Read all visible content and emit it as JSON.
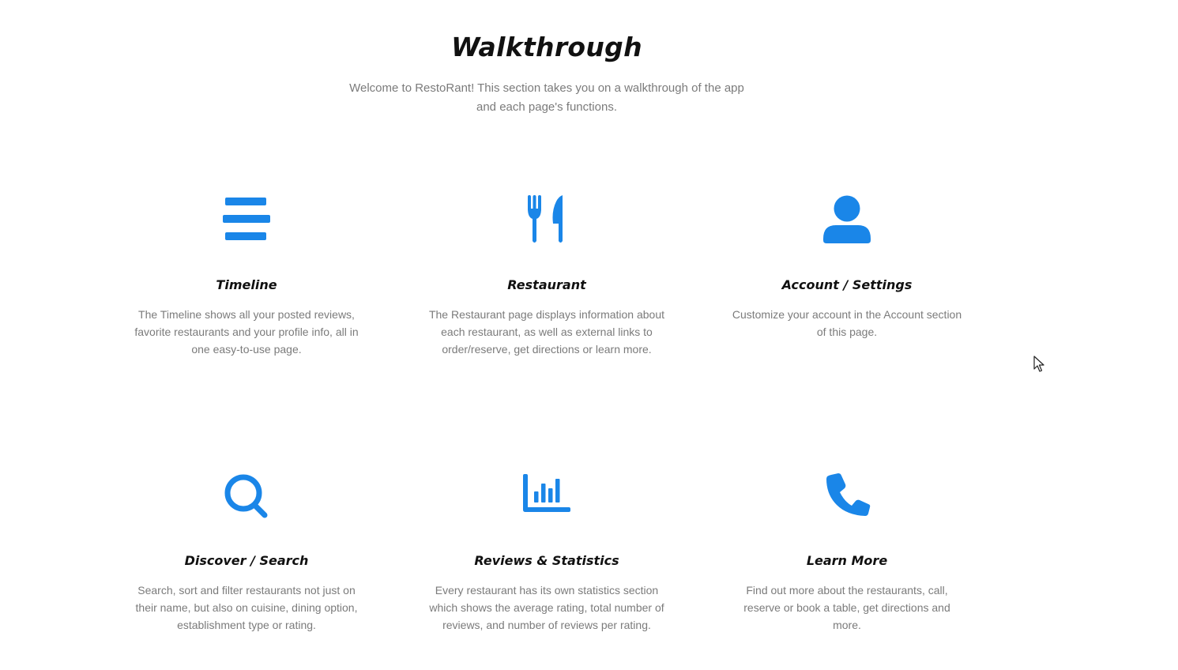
{
  "page": {
    "title": "Walkthrough",
    "intro_line1": "Welcome to RestoRant! This section takes you on a walkthrough of the app",
    "intro_line2": "and each page's functions."
  },
  "theme": {
    "accent_color": "#1a86e8",
    "title_color": "#111111",
    "text_color": "#7b7b7b"
  },
  "features": [
    {
      "icon": "bars-icon",
      "title": "Timeline",
      "description": "The Timeline shows all your posted reviews, favorite restaurants and your profile info, all in one easy-to-use page."
    },
    {
      "icon": "utensils-icon",
      "title": "Restaurant",
      "description": "The Restaurant page displays information about each restaurant, as well as external links to order/reserve, get directions or learn more."
    },
    {
      "icon": "user-icon",
      "title": "Account / Settings",
      "description": "Customize your account in the Account section of this page."
    },
    {
      "icon": "search-icon",
      "title": "Discover / Search",
      "description": "Search, sort and filter restaurants not just on their name, but also on cuisine, dining option, establishment type or rating."
    },
    {
      "icon": "bar-chart-icon",
      "title": "Reviews & Statistics",
      "description": "Every restaurant has its own statistics section which shows the average rating, total number of reviews, and number of reviews per rating."
    },
    {
      "icon": "phone-icon",
      "title": "Learn More",
      "description": "Find out more about the restaurants, call, reserve or book a table, get directions and more."
    }
  ]
}
